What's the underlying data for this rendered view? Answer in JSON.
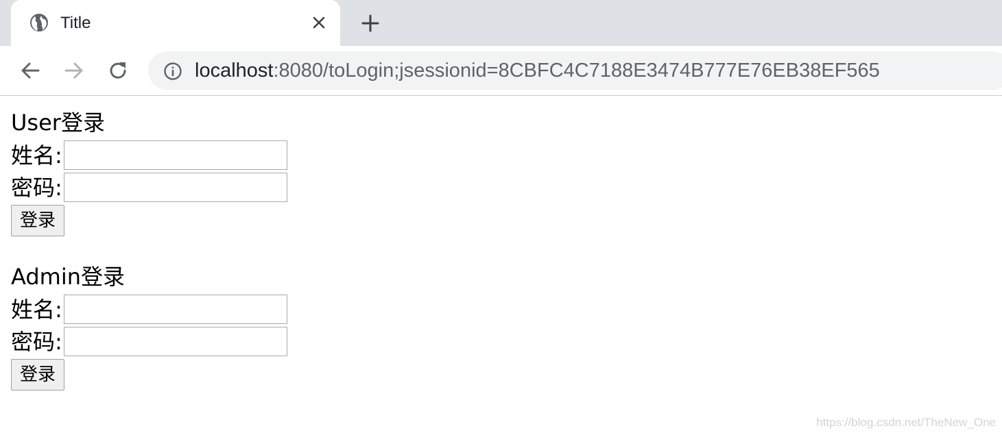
{
  "browser": {
    "tab": {
      "title": "Title",
      "favicon": "globe-icon",
      "close_icon": "close-icon"
    },
    "new_tab_icon": "plus-icon",
    "nav": {
      "back_icon": "arrow-left-icon",
      "forward_icon": "arrow-right-icon",
      "reload_icon": "reload-icon"
    },
    "address": {
      "info_icon": "info-icon",
      "host": "localhost",
      "rest": ":8080/toLogin;jsessionid=8CBFC4C7188E3474B777E76EB38EF565"
    }
  },
  "user_form": {
    "title": "User登录",
    "name_label": "姓名:",
    "name_value": "",
    "password_label": "密码:",
    "password_value": "",
    "submit_label": "登录"
  },
  "admin_form": {
    "title": "Admin登录",
    "name_label": "姓名:",
    "name_value": "",
    "password_label": "密码:",
    "password_value": "",
    "submit_label": "登录"
  },
  "watermark": "https://blog.csdn.net/TheNew_One",
  "colors": {
    "tabstrip_bg": "#dee1e6",
    "omnibox_bg": "#f1f3f4",
    "url_host": "#202124",
    "url_rest": "#5f6368",
    "forward_disabled": "#b0b3b6",
    "watermark": "#d4d4d4"
  }
}
